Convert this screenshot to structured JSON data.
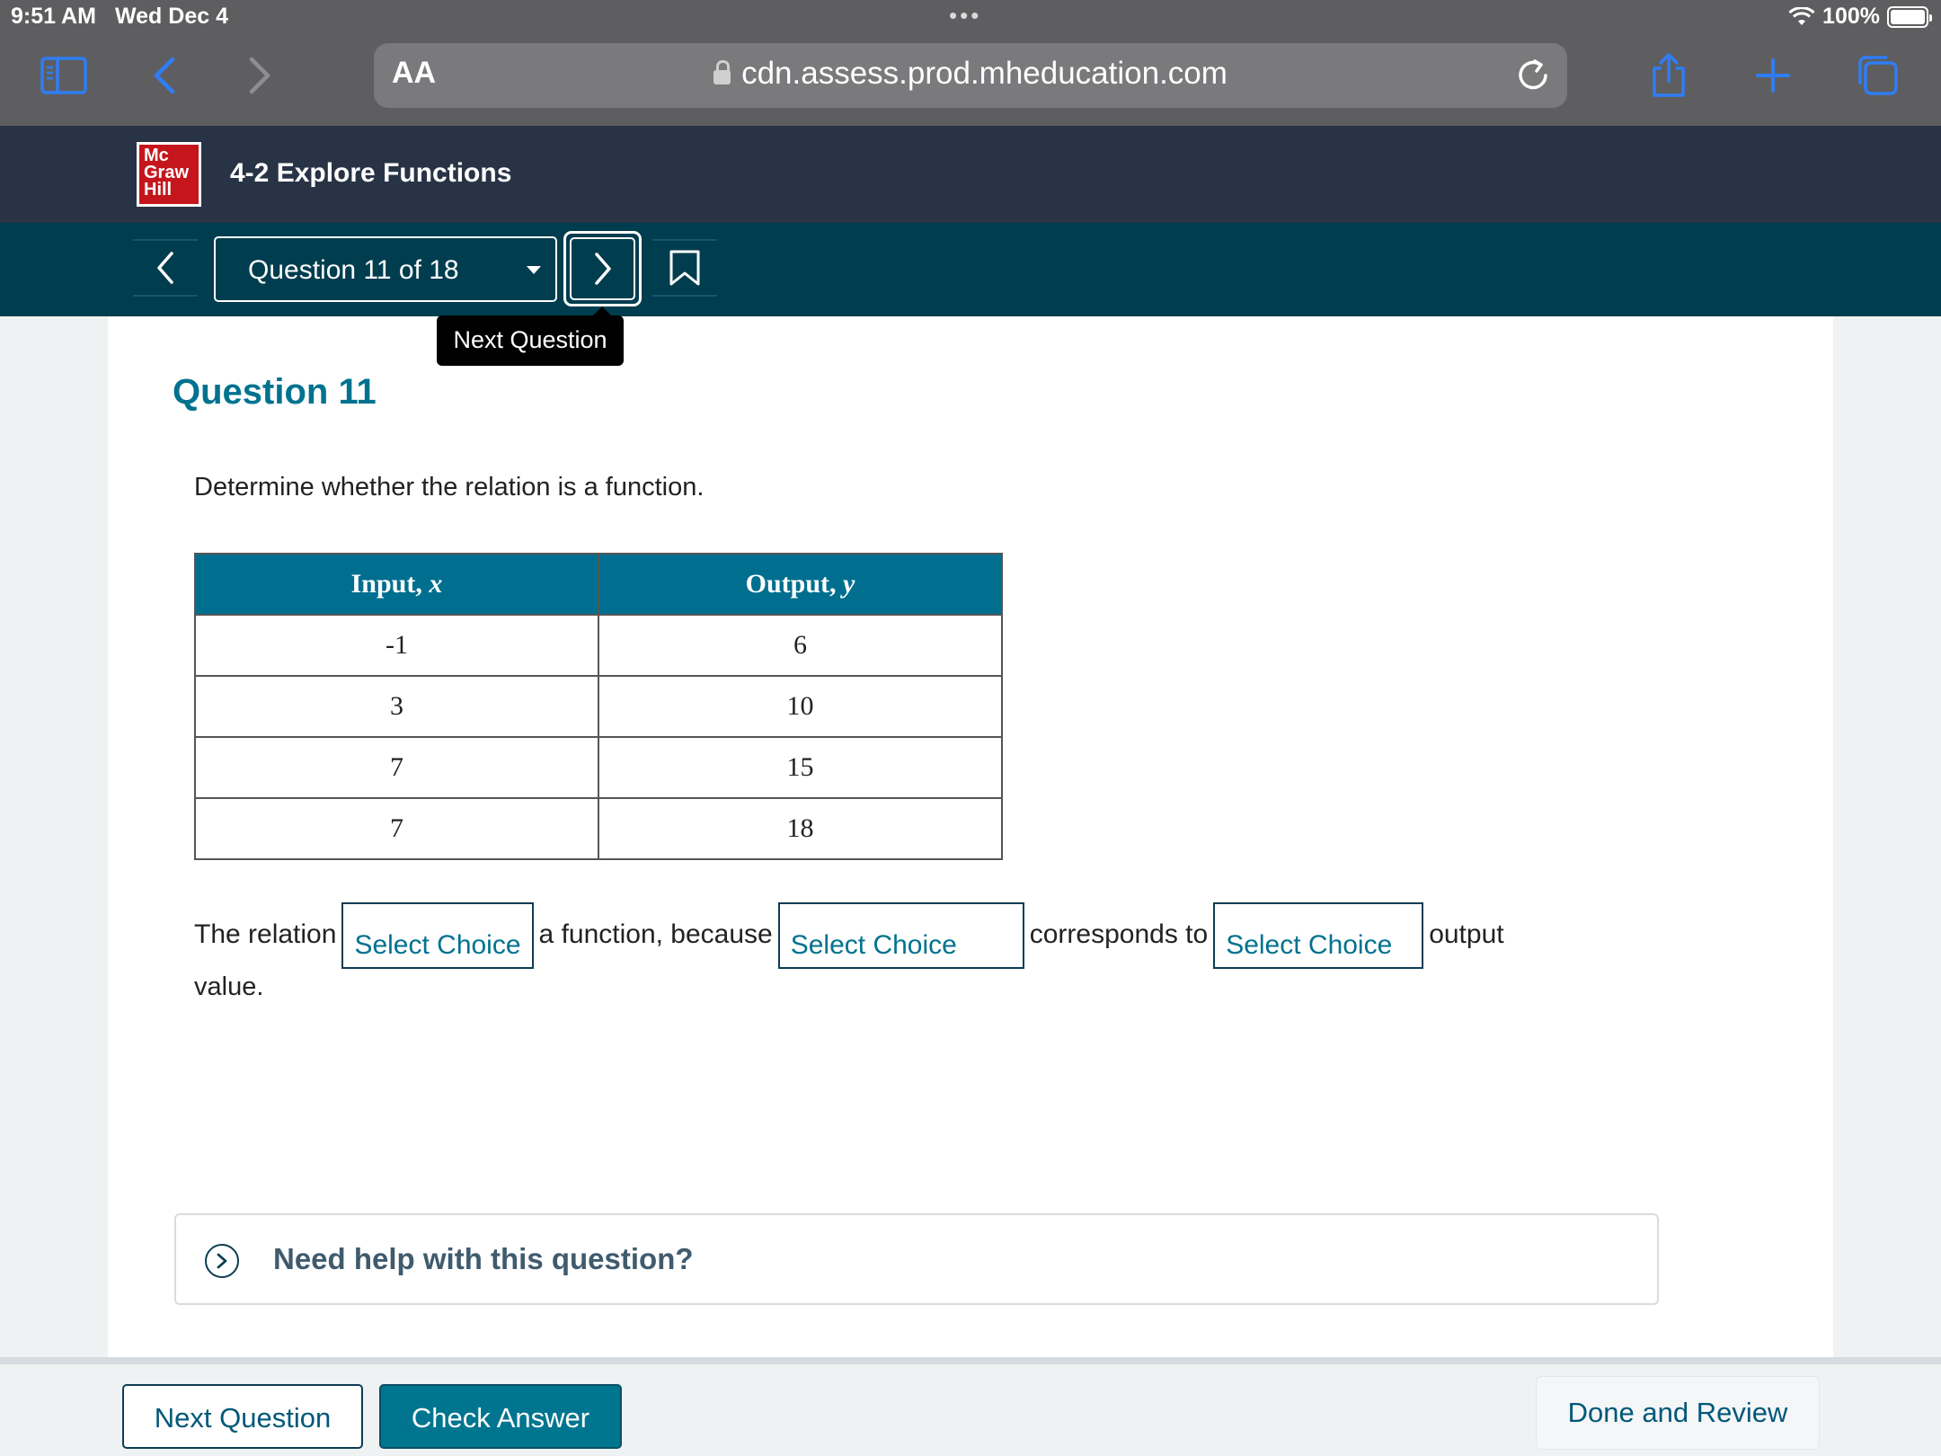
{
  "status_bar": {
    "time": "9:51 AM",
    "date": "Wed Dec 4",
    "dots": "•••",
    "battery": "100%"
  },
  "browser": {
    "aa_label": "AA",
    "url": "cdn.assess.prod.mheducation.com",
    "icons": [
      "sidebar-icon",
      "back-icon",
      "forward-icon",
      "lock-icon",
      "reload-icon",
      "share-icon",
      "plus-icon",
      "tabs-icon"
    ]
  },
  "app": {
    "logo_lines": [
      "Mc",
      "Graw",
      "Hill"
    ],
    "title": "4-2 Explore Functions"
  },
  "qnav": {
    "selector_label": "Question 11 of 18",
    "tooltip": "Next Question"
  },
  "question": {
    "heading": "Question 11",
    "prompt": "Determine whether the relation is a function.",
    "table": {
      "headers": [
        {
          "label": "Input, ",
          "var": "x"
        },
        {
          "label": "Output, ",
          "var": "y"
        }
      ],
      "rows": [
        [
          "-1",
          "6"
        ],
        [
          "3",
          "10"
        ],
        [
          "7",
          "15"
        ],
        [
          "7",
          "18"
        ]
      ]
    },
    "sentence": {
      "part1": "The relation",
      "choice1": "Select Choice",
      "part2": "a function, because",
      "choice2": "Select Choice",
      "part3": "corresponds to",
      "choice3": "Select Choice",
      "part4": "output",
      "part5": "value."
    },
    "help": "Need help with this question?"
  },
  "footer": {
    "next": "Next Question",
    "check": "Check Answer",
    "done": "Done and Review"
  },
  "colors": {
    "teal_accent": "#00728f",
    "header_dark": "#283445",
    "nav_dark": "#003d4f",
    "brand_red": "#c4161c"
  }
}
